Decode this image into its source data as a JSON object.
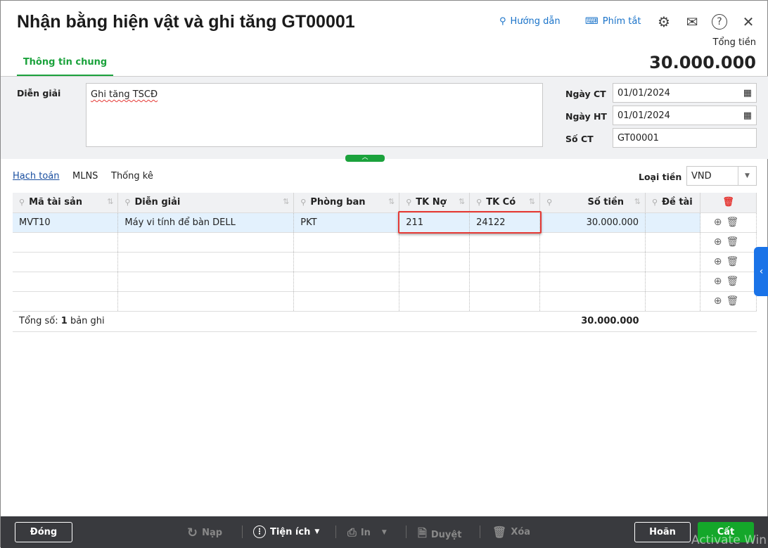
{
  "header": {
    "title": "Nhận bằng hiện vật và ghi tăng GT00001",
    "guide": "Hướng dẫn",
    "shortcuts": "Phím tắt",
    "total_label": "Tổng tiền",
    "total_value": "30.000.000"
  },
  "tabs": [
    {
      "label": "Thông tin chung",
      "active": true
    }
  ],
  "form": {
    "dien_giai_label": "Diễn giải",
    "dien_giai_value": "Ghi tăng TSCĐ",
    "ngay_ct_label": "Ngày CT",
    "ngay_ct": "01/01/2024",
    "ngay_ht_label": "Ngày HT",
    "ngay_ht": "01/01/2024",
    "so_ct_label": "Số CT",
    "so_ct": "GT00001"
  },
  "subtabs": [
    {
      "label": "Hạch toán",
      "active": true
    },
    {
      "label": "MLNS"
    },
    {
      "label": "Thống kê"
    }
  ],
  "currency": {
    "label": "Loại tiền",
    "value": "VND"
  },
  "grid": {
    "columns": [
      "Mã tài sản",
      "Diễn giải",
      "Phòng ban",
      "TK Nợ",
      "TK Có",
      "Số tiền",
      "Đề tài"
    ],
    "rows": [
      [
        "MVT10",
        "Máy vi tính để bàn DELL",
        "PKT",
        "211",
        "24122",
        "30.000.000",
        ""
      ]
    ],
    "total_prefix": "Tổng số:",
    "total_count": "1",
    "total_suffix": "bản ghi",
    "total_amount": "30.000.000"
  },
  "footer": {
    "close": "Đóng",
    "reload": "Nạp",
    "utilities": "Tiện ích",
    "print": "In",
    "approve": "Duyệt",
    "delete": "Xóa",
    "cancel": "Hoãn",
    "save": "Cất"
  },
  "watermark": "Activate Win",
  "colors": {
    "accent": "#1ba23c",
    "link": "#1a73c9",
    "highlight": "#e53935"
  }
}
